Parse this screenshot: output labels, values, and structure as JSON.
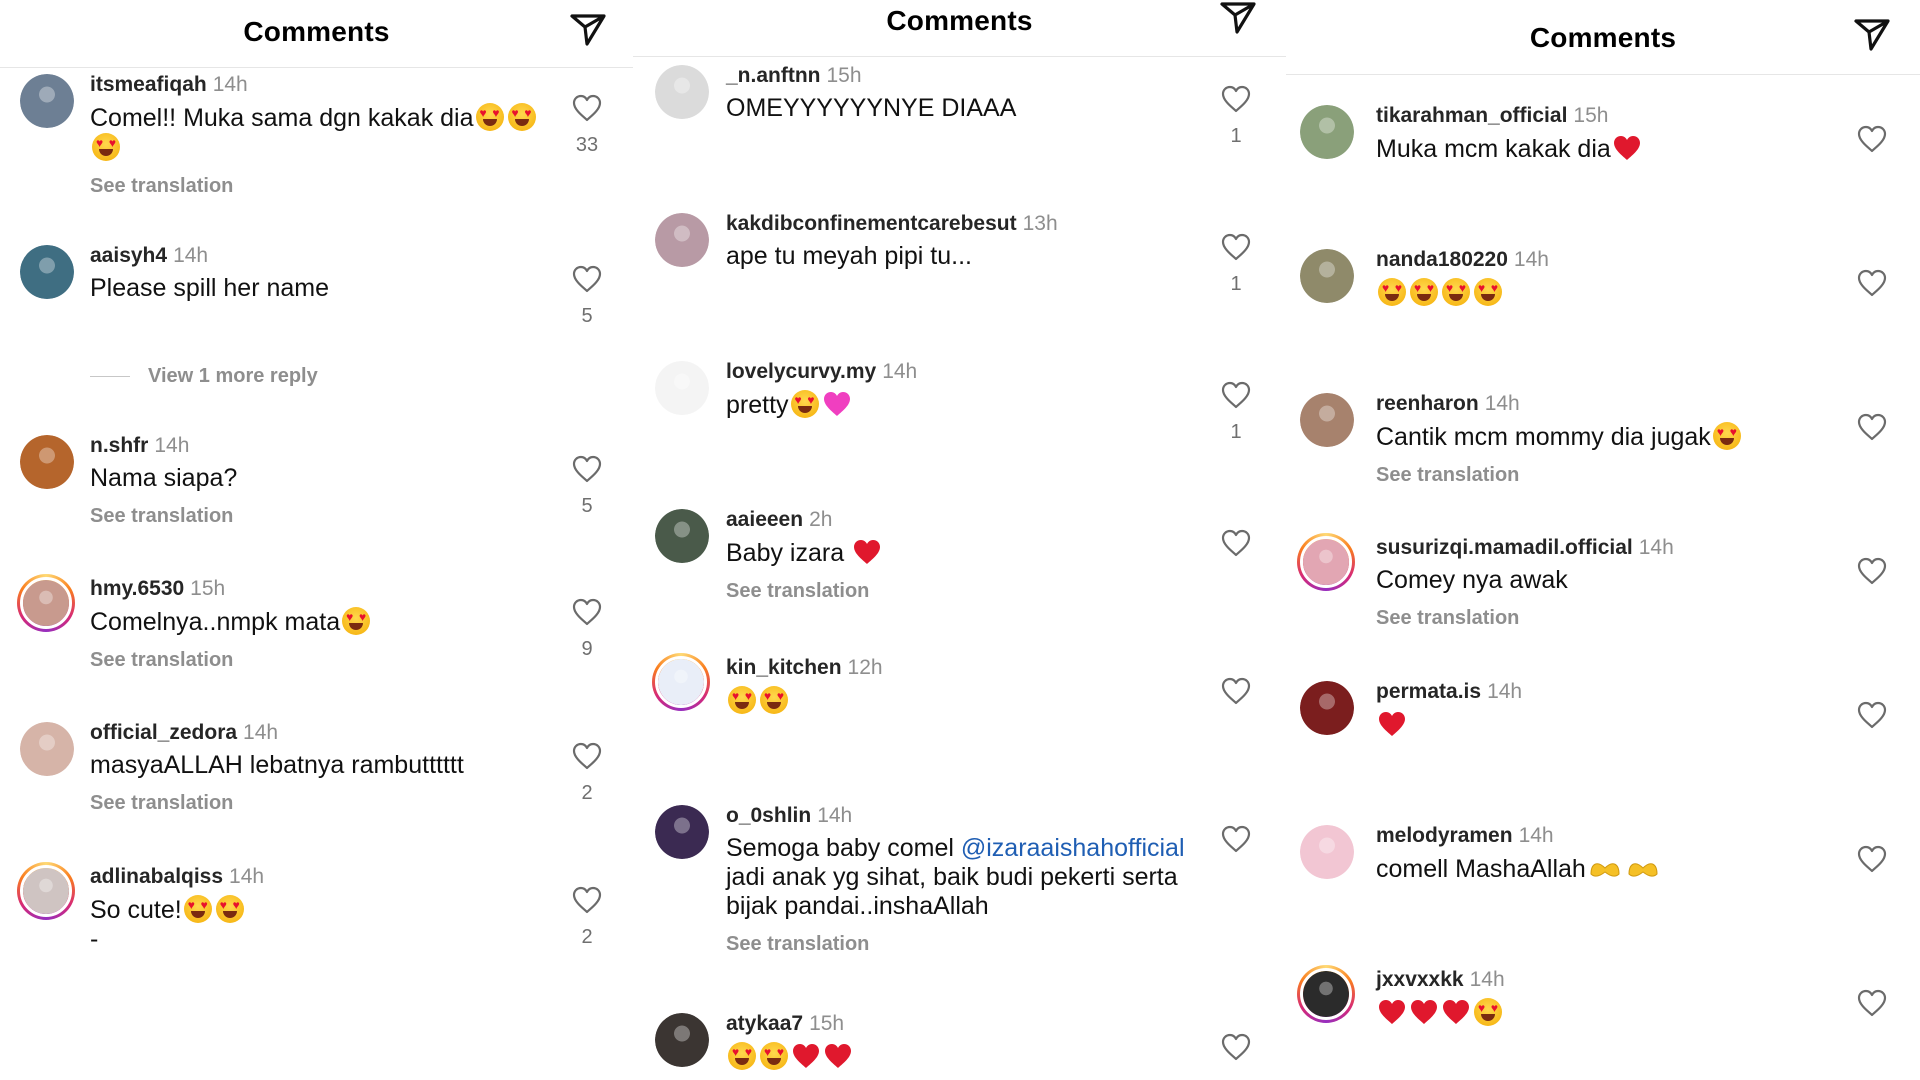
{
  "panels": [
    {
      "title": "Comments",
      "comments": [
        {
          "user": "itsmeafiqah",
          "time": "14h",
          "text": "Comel!! Muka sama dgn kakak dia",
          "emoji": [
            "heart-eyes",
            "heart-eyes",
            "heart-eyes"
          ],
          "see_translation": "See translation",
          "likes": "33",
          "avatar_color": "#6d7f94",
          "ring": false
        },
        {
          "user": "aaisyh4",
          "time": "14h",
          "text": "Please spill her name",
          "emoji": [],
          "see_translation": "",
          "likes": "5",
          "avatar_color": "#3f6e82",
          "ring": false
        },
        {
          "user": "n.shfr",
          "time": "14h",
          "text": "Nama siapa?",
          "emoji": [],
          "see_translation": "See translation",
          "likes": "5",
          "avatar_color": "#b5652c",
          "ring": false
        },
        {
          "user": "hmy.6530",
          "time": "15h",
          "text": "Comelnya..nmpk mata",
          "emoji": [
            "heart-eyes"
          ],
          "see_translation": "See translation",
          "likes": "9",
          "avatar_color": "#c89a8e",
          "ring": true
        },
        {
          "user": "official_zedora",
          "time": "14h",
          "text": "masyaALLAH lebatnya rambutttttt",
          "emoji": [],
          "see_translation": "See translation",
          "likes": "2",
          "avatar_color": "#d6b4a8",
          "ring": false
        },
        {
          "user": "adlinabalqiss",
          "time": "14h",
          "text": "So cute!",
          "emoji": [
            "heart-eyes",
            "heart-eyes"
          ],
          "see_translation": "",
          "likes": "2",
          "avatar_color": "#cfc4c2",
          "ring": true,
          "extra": "-"
        }
      ],
      "view_more": "View 1 more reply"
    },
    {
      "title": "Comments",
      "comments": [
        {
          "user": "_n.anftnn",
          "time": "15h",
          "text": "OMEYYYYYYNYE DIAAA",
          "emoji": [],
          "see_translation": "",
          "likes": "1",
          "avatar_color": "#dbdbdb",
          "ring": false
        },
        {
          "user": "kakdibconfinementcarebesut",
          "time": "13h",
          "text": "ape tu meyah pipi tu...",
          "emoji": [],
          "see_translation": "",
          "likes": "1",
          "avatar_color": "#b89aa5",
          "ring": false
        },
        {
          "user": "lovelycurvy.my",
          "time": "14h",
          "text": "pretty",
          "emoji": [
            "heart-eyes",
            "pink-heart"
          ],
          "see_translation": "",
          "likes": "1",
          "avatar_color": "#f4f4f4",
          "ring": false
        },
        {
          "user": "aaieeen",
          "time": "2h",
          "text": "Baby izara ",
          "emoji": [
            "red-heart"
          ],
          "see_translation": "See translation",
          "likes": "",
          "avatar_color": "#4a5a4a",
          "ring": false
        },
        {
          "user": "kin_kitchen",
          "time": "12h",
          "text": "",
          "emoji": [
            "heart-eyes",
            "heart-eyes"
          ],
          "see_translation": "",
          "likes": "",
          "avatar_color": "#e9eef8",
          "ring": true
        },
        {
          "user": "o_0shlin",
          "time": "14h",
          "text_before": "Semoga baby comel ",
          "mention": "@izaraaishahofficial",
          "text": "jadi anak yg sihat, baik budi pekerti serta bijak pandai..inshaAllah",
          "emoji": [],
          "see_translation": "See translation",
          "likes": "",
          "avatar_color": "#3b2a52",
          "ring": false
        },
        {
          "user": "atykaa7",
          "time": "15h",
          "text": "",
          "emoji": [
            "heart-eyes",
            "heart-eyes",
            "red-heart",
            "red-heart"
          ],
          "see_translation": "",
          "likes": "",
          "avatar_color": "#3b3532",
          "ring": false
        }
      ]
    },
    {
      "title": "Comments",
      "comments": [
        {
          "user": "tikarahman_official",
          "time": "15h",
          "text": "Muka mcm kakak dia",
          "emoji": [
            "red-heart"
          ],
          "see_translation": "",
          "likes": "",
          "avatar_color": "#8aa07a",
          "ring": false
        },
        {
          "user": "nanda180220",
          "time": "14h",
          "text": "",
          "emoji": [
            "heart-eyes",
            "heart-eyes",
            "heart-eyes",
            "heart-eyes"
          ],
          "see_translation": "",
          "likes": "",
          "avatar_color": "#8f8a6a",
          "ring": false
        },
        {
          "user": "reenharon",
          "time": "14h",
          "text": "Cantik mcm mommy dia jugak",
          "emoji": [
            "heart-eyes"
          ],
          "see_translation": "See translation",
          "likes": "",
          "avatar_color": "#a7826d",
          "ring": false
        },
        {
          "user": "susurizqi.mamadil.official",
          "time": "14h",
          "text": "Comey nya awak",
          "emoji": [],
          "see_translation": "See translation",
          "likes": "",
          "avatar_color": "#e2a6b3",
          "ring": true
        },
        {
          "user": "permata.is",
          "time": "14h",
          "text": "",
          "emoji": [
            "red-heart"
          ],
          "see_translation": "",
          "likes": "",
          "avatar_color": "#7b1e1e",
          "ring": false
        },
        {
          "user": "melodyramen",
          "time": "14h",
          "text": "comell MashaAllah",
          "emoji": [
            "heart-hands",
            "heart-hands"
          ],
          "see_translation": "",
          "likes": "",
          "avatar_color": "#f2c6d3",
          "ring": false
        },
        {
          "user": "jxxvxxkk",
          "time": "14h",
          "text": "",
          "emoji": [
            "red-heart",
            "red-heart",
            "red-heart",
            "heart-eyes"
          ],
          "see_translation": "",
          "likes": "",
          "avatar_color": "#2b2b2b",
          "ring": true
        }
      ]
    }
  ],
  "colors": {
    "username": "#262626",
    "meta": "#8e8e8e",
    "mention": "#1f5eb3"
  }
}
